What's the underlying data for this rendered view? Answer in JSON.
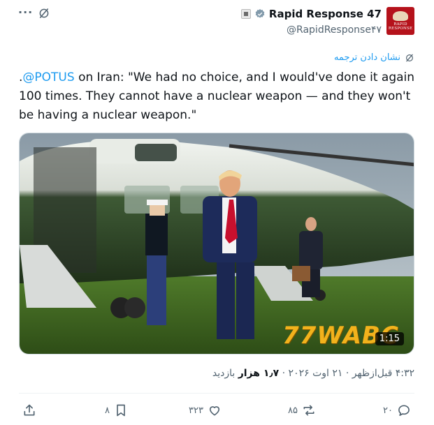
{
  "header": {
    "more_label": "···",
    "display_name": "Rapid Response 47",
    "handle": "@RapidResponse۴۷",
    "avatar_text": "RAPID RESPONSE"
  },
  "translate_label": "نشان دادن ترجمه",
  "tweet": {
    "prefix": ".",
    "mention": "@POTUS",
    "body": " on Iran: \"We had no choice, and I would've done it again 100 times. They cannot have a nuclear weapon — and they won't be having a nuclear weapon.\""
  },
  "media": {
    "watermark": "77WABC",
    "duration": "1:15"
  },
  "meta": {
    "time": "۴:۳۲ قبل‌ازظهر",
    "sep1": " · ",
    "date": "۲۱ اوت ۲۰۲۶",
    "sep2": " · ",
    "views_count": "۱٫۷ هزار",
    "views_label": " بازدید"
  },
  "actions": {
    "replies": "۲۰",
    "reposts": "۸۵",
    "likes": "۳۲۳",
    "bookmarks": "۸"
  },
  "colors": {
    "accent": "#1d9bf0",
    "text": "#0f1419",
    "secondary": "#536471",
    "avatar_bg": "#b5121b",
    "watermark": "#f2b21c"
  }
}
